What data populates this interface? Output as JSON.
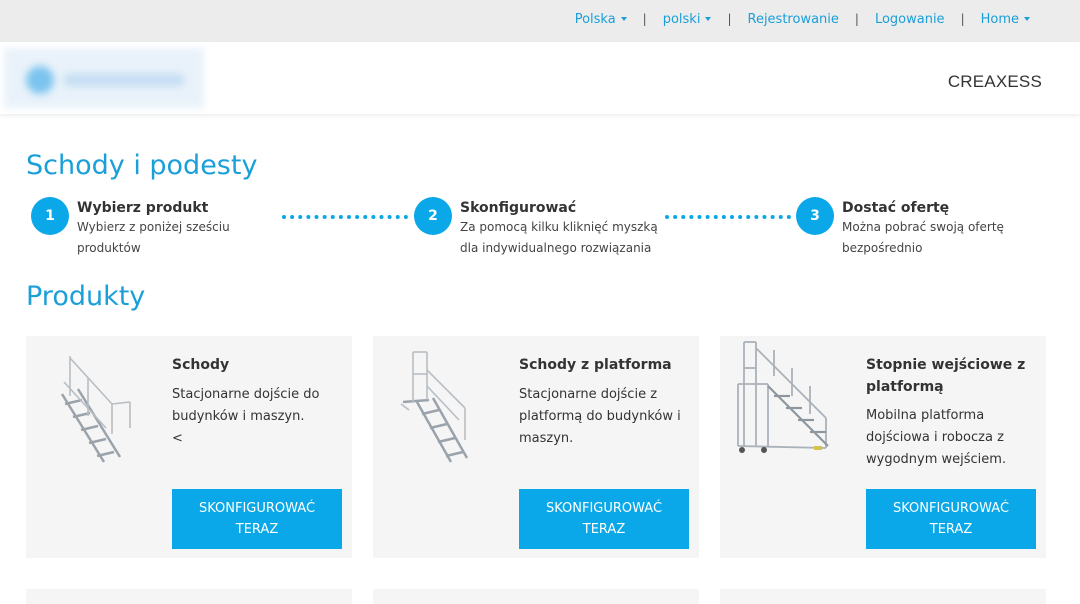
{
  "topnav": {
    "country": "Polska",
    "language": "polski",
    "register": "Rejestrowanie",
    "login": "Logowanie",
    "home": "Home"
  },
  "header": {
    "brand": "CREAXESS"
  },
  "main": {
    "title": "Schody i podesty",
    "steps": [
      {
        "number": "1",
        "title": "Wybierz produkt",
        "line1": "Wybierz z poniżej sześciu",
        "line2": "produktów"
      },
      {
        "number": "2",
        "title": "Skonfigurować",
        "line1": "Za pomocą kilku kliknięć myszką",
        "line2": "dla indywidualnego rozwiązania"
      },
      {
        "number": "3",
        "title": "Dostać ofertę",
        "line1": "Można pobrać swoją ofertę",
        "line2": "bezpośrednio"
      }
    ],
    "products_title": "Produkty",
    "products": [
      {
        "title": "Schody",
        "description": "Stacjonarne dojście do budynków i maszyn.",
        "extra": "<",
        "button": "SKONFIGUROWAĆ TERAZ"
      },
      {
        "title": "Schody z platforma",
        "description": "Stacjonarne dojście z platformą do budynków i maszyn.",
        "button": "SKONFIGUROWAĆ TERAZ"
      },
      {
        "title": "Stopnie wejściowe z platformą",
        "description": "Mobilna platforma dojściowa i robocza z wygodnym wejściem.",
        "button": "SKONFIGUROWAĆ TERAZ"
      }
    ]
  },
  "colors": {
    "accent": "#0aa8e8",
    "heading": "#1a9fd9",
    "card_bg": "#f5f5f5",
    "topbar_bg": "#ececec"
  }
}
